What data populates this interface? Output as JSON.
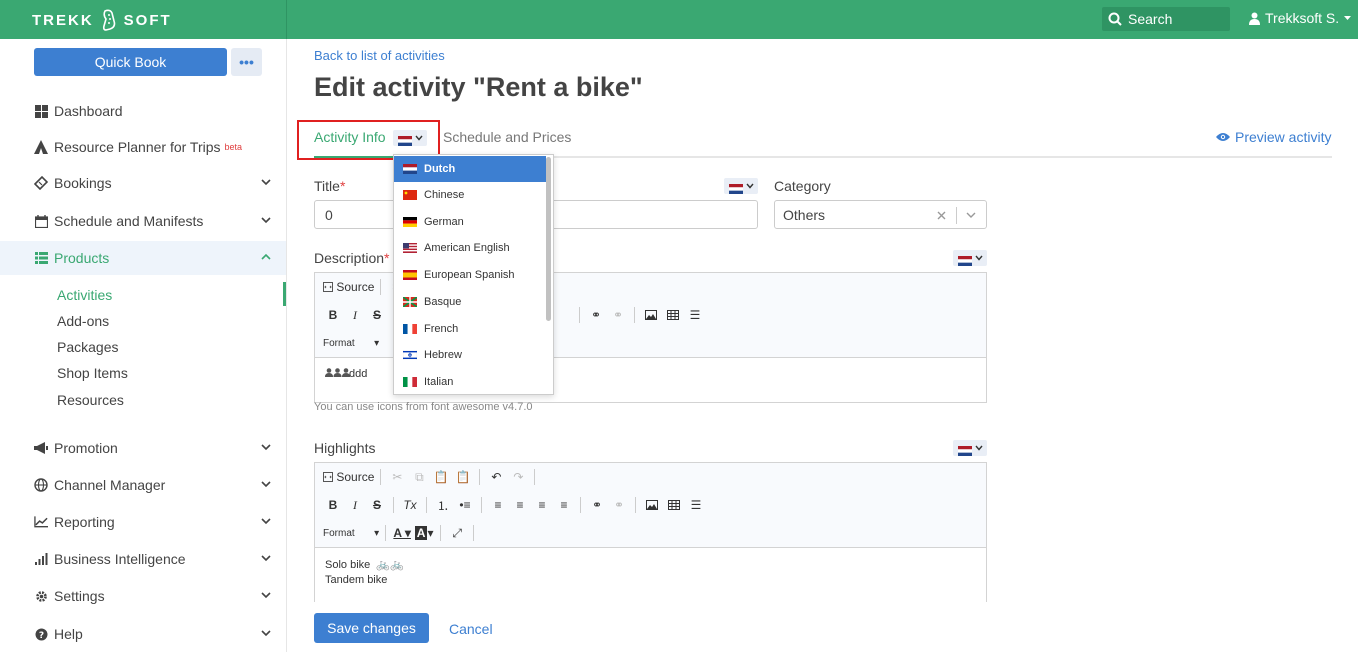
{
  "app": {
    "logo_left": "TREKK",
    "logo_right": "SOFT",
    "search_label": "Search",
    "user_name": "Trekksoft S."
  },
  "colors": {
    "brand_green": "#3aa872",
    "primary_blue": "#3d7fd1",
    "required_red": "#e04040"
  },
  "sidebar": {
    "quick_book": "Quick Book",
    "more": "•••",
    "items": [
      {
        "label": "Dashboard",
        "icon": "grid-icon"
      },
      {
        "label": "Resource Planner for Trips",
        "badge": "beta",
        "icon": "tent-icon"
      },
      {
        "label": "Bookings",
        "icon": "ticket-icon"
      },
      {
        "label": "Schedule and Manifests",
        "icon": "calendar-icon"
      },
      {
        "label": "Products",
        "icon": "list-icon"
      },
      {
        "label": "Promotion",
        "icon": "megaphone-icon"
      },
      {
        "label": "Channel Manager",
        "icon": "globe-icon"
      },
      {
        "label": "Reporting",
        "icon": "line-chart-icon"
      },
      {
        "label": "Business Intelligence",
        "icon": "bar-chart-icon"
      },
      {
        "label": "Settings",
        "icon": "gear-icon"
      },
      {
        "label": "Help",
        "icon": "question-icon"
      }
    ],
    "sub_items": [
      "Activities",
      "Add-ons",
      "Packages",
      "Shop Items",
      "Resources"
    ]
  },
  "main": {
    "back_link": "Back to list of activities",
    "title": "Edit activity \"Rent a bike\"",
    "tab_activity_info": "Activity Info",
    "tab_schedule": "Schedule and Prices",
    "preview": "Preview activity",
    "title_label": "Title",
    "required_mark": "*",
    "title_value": "0",
    "category_label": "Category",
    "category_value": "Others",
    "description_label": "Description",
    "highlights_label": "Highlights",
    "hint": "You can use icons from font awesome v4.7.0",
    "toolbar_source": "Source",
    "toolbar_format": "Format",
    "description_body": "ddd",
    "highlights_line1": "Solo bike",
    "highlights_line2": "Tandem bike",
    "save": "Save changes",
    "cancel": "Cancel"
  },
  "language_dropdown": {
    "selected": "Dutch",
    "options": [
      "Dutch",
      "Chinese",
      "German",
      "American English",
      "European Spanish",
      "Basque",
      "French",
      "Hebrew",
      "Italian"
    ]
  }
}
